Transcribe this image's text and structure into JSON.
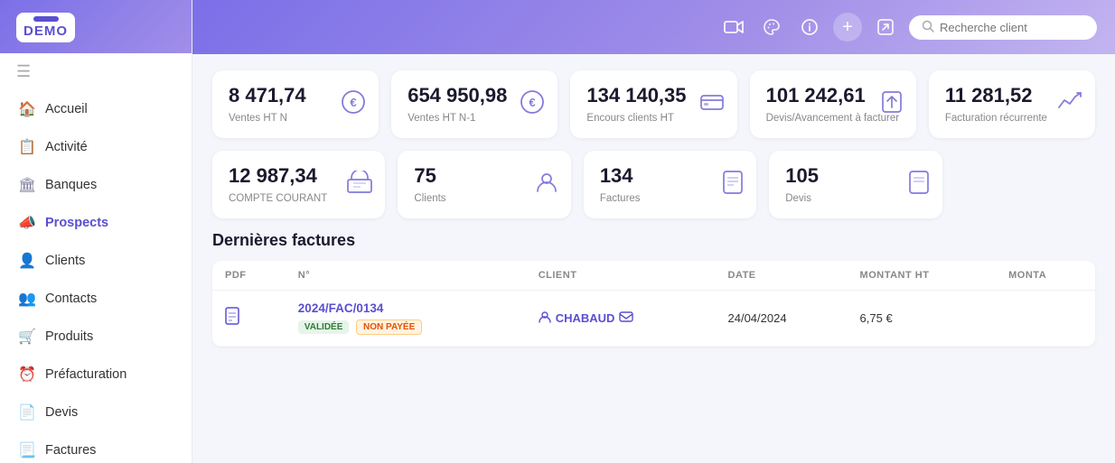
{
  "logo": {
    "text": "DEMO"
  },
  "header": {
    "search_placeholder": "Recherche client"
  },
  "sidebar": {
    "items": [
      {
        "id": "accueil",
        "label": "Accueil",
        "icon": "🏠"
      },
      {
        "id": "activite",
        "label": "Activité",
        "icon": "📋"
      },
      {
        "id": "banques",
        "label": "Banques",
        "icon": "🏛"
      },
      {
        "id": "prospects",
        "label": "Prospects",
        "icon": "📣"
      },
      {
        "id": "clients",
        "label": "Clients",
        "icon": "👤"
      },
      {
        "id": "contacts",
        "label": "Contacts",
        "icon": "👥"
      },
      {
        "id": "produits",
        "label": "Produits",
        "icon": "🛒"
      },
      {
        "id": "prefacturation",
        "label": "Préfacturation",
        "icon": "⏰"
      },
      {
        "id": "devis",
        "label": "Devis",
        "icon": "📄"
      },
      {
        "id": "factures",
        "label": "Factures",
        "icon": "📃"
      }
    ]
  },
  "kpi_row1": [
    {
      "id": "ventes-ht-n",
      "value": "8 471,74",
      "label": "Ventes HT N",
      "icon": "€"
    },
    {
      "id": "ventes-ht-n1",
      "value": "654 950,98",
      "label": "Ventes HT N-1",
      "icon": "€"
    },
    {
      "id": "encours",
      "value": "134 140,35",
      "label": "Encours clients HT",
      "icon": "💳"
    },
    {
      "id": "devis-avancement",
      "value": "101 242,61",
      "label": "Devis/Avancement à facturer",
      "icon": "⬆"
    },
    {
      "id": "facturation-recurrente",
      "value": "11 281,52",
      "label": "Facturation récurrente",
      "icon": "📈"
    }
  ],
  "kpi_row2": [
    {
      "id": "compte-courant",
      "value": "12 987,34",
      "label": "COMPTE COURANT",
      "icon": "🏦"
    },
    {
      "id": "clients",
      "value": "75",
      "label": "Clients",
      "icon": "👤"
    },
    {
      "id": "factures",
      "value": "134",
      "label": "Factures",
      "icon": "📄"
    },
    {
      "id": "devis",
      "value": "105",
      "label": "Devis",
      "icon": "📄"
    }
  ],
  "section_title": "Dernières factures",
  "table": {
    "columns": [
      "PDF",
      "N°",
      "CLIENT",
      "DATE",
      "MONTANT HT",
      "MONTA"
    ],
    "rows": [
      {
        "pdf": "📄",
        "numero": "2024/FAC/0134",
        "badges": [
          "VALIDÉE",
          "NON PAYÉE"
        ],
        "client": "CHABAUD",
        "client_icon": "👤",
        "email_icon": "✉",
        "date": "24/04/2024",
        "montant_ht": "6,75 €",
        "monta": ""
      }
    ]
  },
  "icons": {
    "camera": "📹",
    "palette": "🎨",
    "info": "ℹ",
    "plus": "+",
    "export": "↗",
    "search": "🔍",
    "menu": "☰"
  }
}
